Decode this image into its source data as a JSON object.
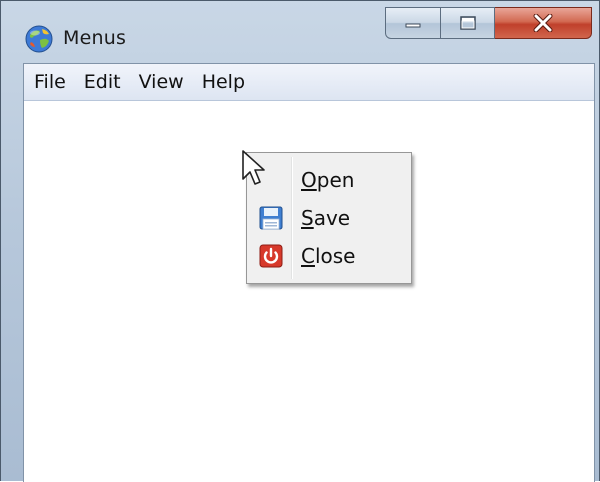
{
  "window": {
    "title": "Menus",
    "icon": "app-globe-icon",
    "controls": [
      "minimize-icon",
      "maximize-icon",
      "close-icon"
    ]
  },
  "menubar": {
    "items": [
      {
        "label": "File"
      },
      {
        "label": "Edit"
      },
      {
        "label": "View"
      },
      {
        "label": "Help"
      }
    ]
  },
  "context_menu": {
    "items": [
      {
        "label_first": "O",
        "label_rest": "pen",
        "icon": null
      },
      {
        "label_first": "S",
        "label_rest": "ave",
        "icon": "save-icon"
      },
      {
        "label_first": "C",
        "label_rest": "lose",
        "icon": "power-icon"
      }
    ]
  },
  "colors": {
    "close_button": "#c0402b",
    "menubar": "#dde5f2",
    "context_menu_bg": "#f0f0f0"
  }
}
